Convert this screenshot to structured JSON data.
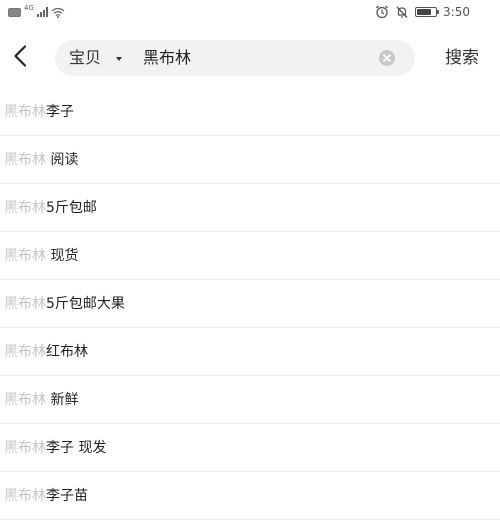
{
  "status_bar": {
    "network_label": "4G",
    "time": "3:50",
    "left_icons": [
      "sim-card-icon",
      "signal-icon",
      "wifi-icon"
    ],
    "right_icons": [
      "alarm-icon",
      "mute-icon",
      "battery-icon"
    ]
  },
  "header": {
    "back_icon": "chevron-left-icon",
    "search": {
      "scope_label": "宝贝",
      "query_value": "黑布林",
      "clear_icon": "clear-icon"
    },
    "search_button_label": "搜索"
  },
  "suggestions": {
    "items": [
      {
        "prefix": "黑布林",
        "rest": "李子"
      },
      {
        "prefix": "黑布林",
        "rest": " 阅读"
      },
      {
        "prefix": "黑布林",
        "rest": "5斤包邮"
      },
      {
        "prefix": "黑布林",
        "rest": " 现货"
      },
      {
        "prefix": "黑布林",
        "rest": "5斤包邮大果"
      },
      {
        "prefix": "黑布林",
        "rest": "红布林"
      },
      {
        "prefix": "黑布林",
        "rest": " 新鲜"
      },
      {
        "prefix": "黑布林",
        "rest": "李子 现发"
      },
      {
        "prefix": "黑布林",
        "rest": "李子苗"
      }
    ]
  },
  "colors": {
    "background": "#ffffff",
    "search_box": "#f2f2f2",
    "prefix_text": "#c4c4c4",
    "primary_text": "#222222",
    "divider": "#ececec"
  }
}
